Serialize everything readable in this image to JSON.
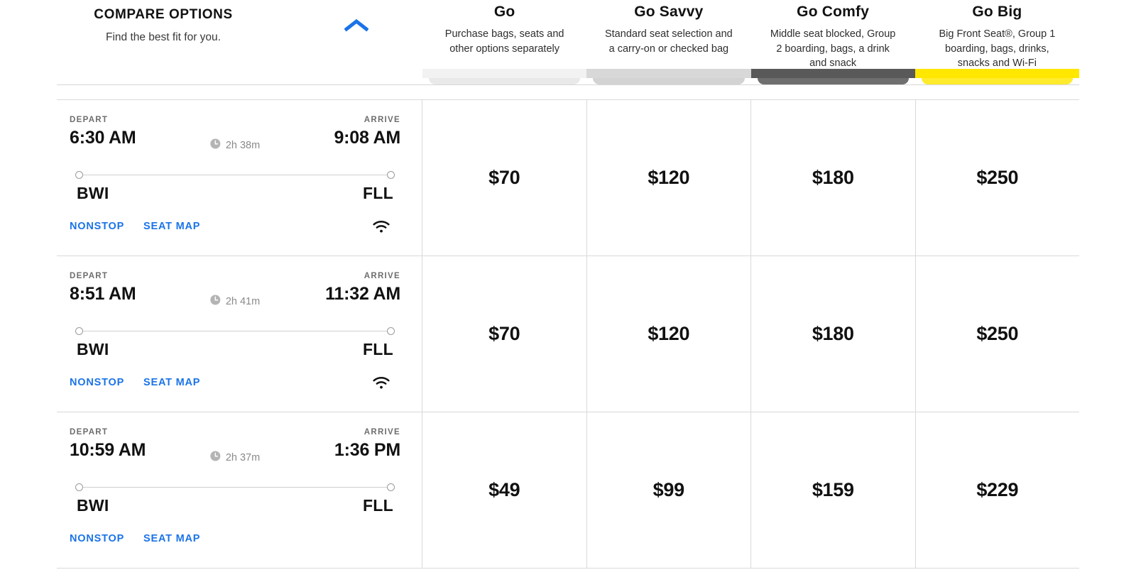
{
  "header": {
    "compare_title": "COMPARE OPTIONS",
    "compare_subtitle": "Find the best fit for you.",
    "collapse_icon": "chevron-up-icon",
    "accent_blue": "#1a73e8"
  },
  "fares": [
    {
      "name": "Go",
      "description": "Purchase bags, seats and other options separately",
      "bar_color": "#f2f2f2",
      "shadow_color": "#e4e4e4"
    },
    {
      "name": "Go Savvy",
      "description": "Standard seat selection and a carry-on or checked bag",
      "bar_color": "#d8d8d8",
      "shadow_color": "#c9c9c9"
    },
    {
      "name": "Go Comfy",
      "description": "Middle seat blocked, Group 2 boarding, bags, a drink and snack",
      "bar_color": "#595959",
      "shadow_color": "#4f4f4f"
    },
    {
      "name": "Go Big",
      "description": "Big Front Seat®, Group 1 boarding, bags, drinks, snacks and Wi-Fi",
      "bar_color": "#ffe700",
      "shadow_color": "#ffe700"
    }
  ],
  "labels": {
    "depart": "DEPART",
    "arrive": "ARRIVE",
    "nonstop": "NONSTOP",
    "seat_map": "SEAT MAP",
    "clock_icon": "clock-icon",
    "wifi_icon": "wifi-icon"
  },
  "flights": [
    {
      "depart_time": "6:30 AM",
      "arrive_time": "9:08 AM",
      "duration": "2h 38m",
      "origin": "BWI",
      "destination": "FLL",
      "stops": "NONSTOP",
      "seat_map": "SEAT MAP",
      "wifi": true,
      "prices": [
        "$70",
        "$120",
        "$180",
        "$250"
      ]
    },
    {
      "depart_time": "8:51 AM",
      "arrive_time": "11:32 AM",
      "duration": "2h 41m",
      "origin": "BWI",
      "destination": "FLL",
      "stops": "NONSTOP",
      "seat_map": "SEAT MAP",
      "wifi": true,
      "prices": [
        "$70",
        "$120",
        "$180",
        "$250"
      ]
    },
    {
      "depart_time": "10:59 AM",
      "arrive_time": "1:36 PM",
      "duration": "2h 37m",
      "origin": "BWI",
      "destination": "FLL",
      "stops": "NONSTOP",
      "seat_map": "SEAT MAP",
      "wifi": false,
      "prices": [
        "$49",
        "$99",
        "$159",
        "$229"
      ]
    }
  ]
}
